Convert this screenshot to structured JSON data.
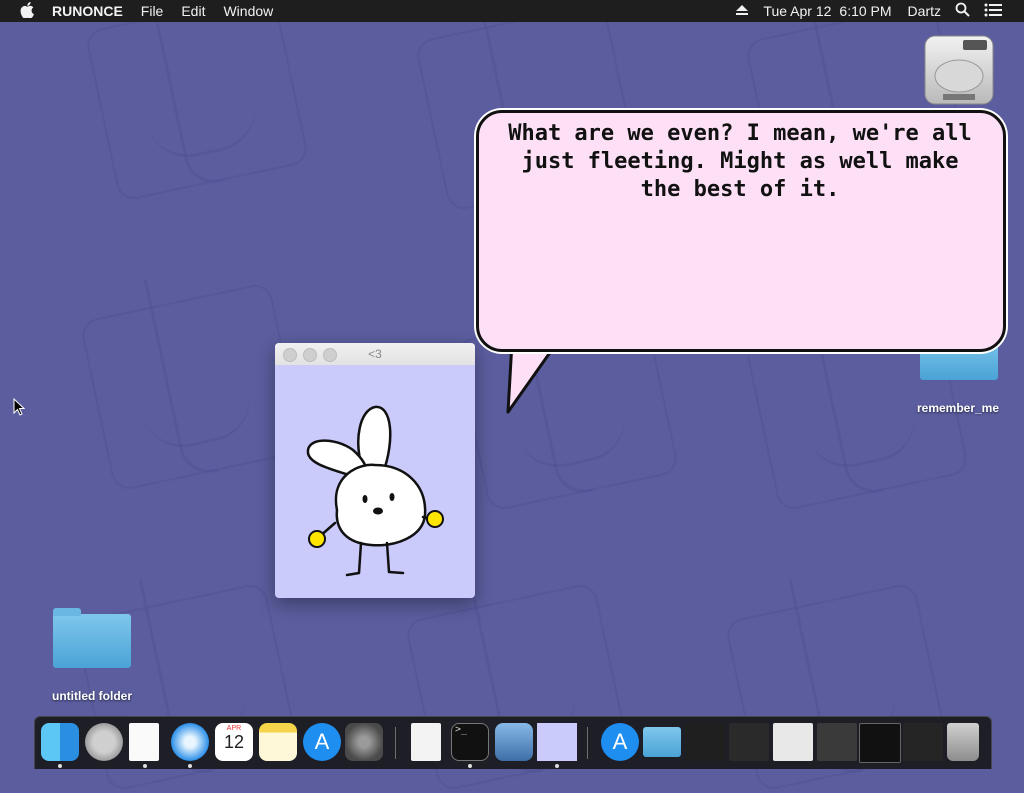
{
  "menubar": {
    "app_name": "RUNONCE",
    "items": [
      "File",
      "Edit",
      "Window"
    ],
    "date": "Tue Apr 12",
    "time": "6:10 PM",
    "user": "Dartz"
  },
  "speech_bubble": {
    "text": "What are we even? I mean, we're all just fleeting. Might as well make the best of it."
  },
  "pet_window": {
    "title": "<3"
  },
  "desktop": {
    "folder_left": "untitled folder",
    "folder_right": "remember_me"
  },
  "dock": {
    "calendar_month": "APR",
    "calendar_day": "12"
  },
  "colors": {
    "desktop": "#5b5d9e",
    "bubble": "#fde0f6",
    "pet_bg": "#cacbfb"
  }
}
